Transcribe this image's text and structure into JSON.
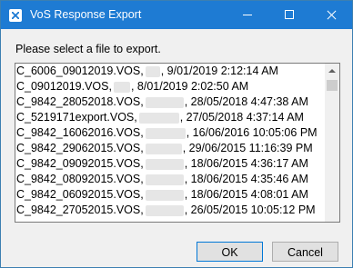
{
  "window": {
    "title": "VoS Response Export",
    "icon": "app-icon"
  },
  "titlebar_buttons": {
    "minimize": "minimize-icon",
    "maximize": "maximize-icon",
    "close": "close-icon"
  },
  "prompt": "Please select a file to export.",
  "files": [
    {
      "name": "C_6006_09012019.VOS,",
      "date": ", 9/01/2019 2:12:14 AM",
      "blur": 16
    },
    {
      "name": "C_09012019.VOS,",
      "date": ", 8/01/2019 2:02:50 AM",
      "blur": 18
    },
    {
      "name": "C_9842_28052018.VOS,",
      "date": ", 28/05/2018 4:47:38 AM",
      "blur": 42
    },
    {
      "name": "C_5219171export.VOS,",
      "date": ", 27/05/2018 4:37:14 AM",
      "blur": 44
    },
    {
      "name": "C_9842_16062016.VOS,",
      "date": ", 16/06/2016 10:05:06 PM",
      "blur": 44
    },
    {
      "name": "C_9842_29062015.VOS,",
      "date": ", 29/06/2015 11:16:39 PM",
      "blur": 40
    },
    {
      "name": "C_9842_09092015.VOS,",
      "date": ", 18/06/2015 4:36:17 AM",
      "blur": 42
    },
    {
      "name": "C_9842_08092015.VOS,",
      "date": ", 18/06/2015 4:35:46 AM",
      "blur": 42
    },
    {
      "name": "C_9842_06092015.VOS,",
      "date": ", 18/06/2015 4:08:01 AM",
      "blur": 42
    },
    {
      "name": "C_9842_27052015.VOS,",
      "date": ", 26/05/2015 10:05:12 PM",
      "blur": 42
    }
  ],
  "buttons": {
    "ok": "OK",
    "cancel": "Cancel"
  }
}
